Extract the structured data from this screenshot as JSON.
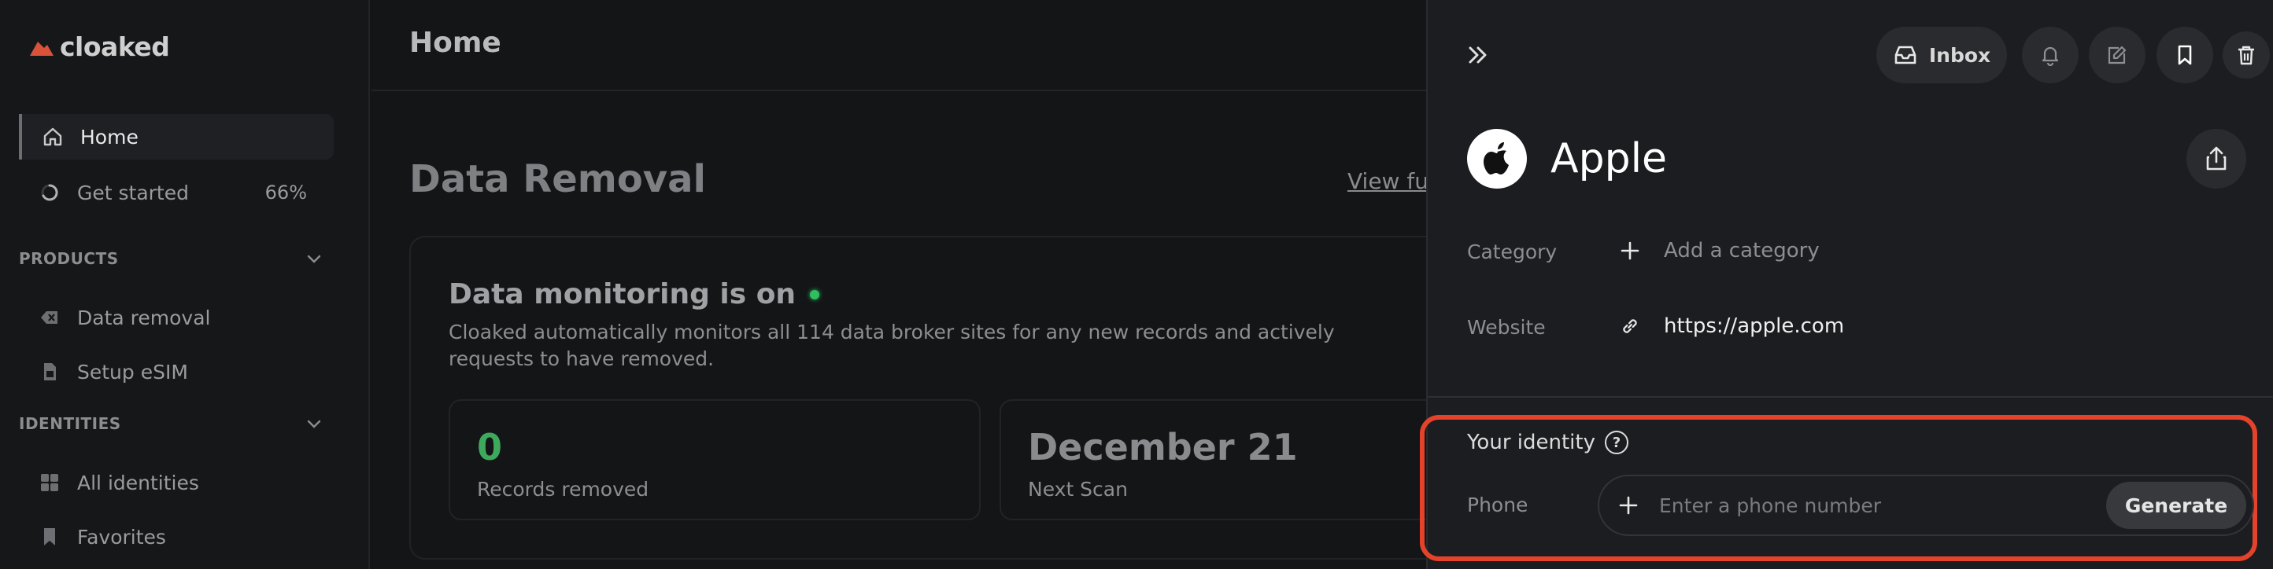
{
  "app": {
    "logo_text": "cloaked"
  },
  "sidebar": {
    "home": "Home",
    "get_started": "Get started",
    "get_started_progress": "66%",
    "products_header": "PRODUCTS",
    "data_removal": "Data removal",
    "setup_esim": "Setup eSIM",
    "identities_header": "IDENTITIES",
    "all_identities": "All identities",
    "favorites": "Favorites"
  },
  "main": {
    "page_title": "Home",
    "section_title": "Data Removal",
    "view_full": "View ful",
    "monitoring_title": "Data monitoring is on",
    "monitoring_desc": "Cloaked automatically monitors all 114 data broker sites for any new records and actively requests to have removed.",
    "stats": [
      {
        "value": "0",
        "label": "Records removed",
        "color": "#3ea95c"
      },
      {
        "value": "December 21",
        "label": "Next Scan",
        "color": "#8a8b8e"
      }
    ]
  },
  "panel": {
    "inbox_label": "Inbox",
    "app_name": "Apple",
    "category_label": "Category",
    "category_value": "Add a category",
    "website_label": "Website",
    "website_value": "https://apple.com",
    "identity_title": "Your identity",
    "phone_label": "Phone",
    "phone_placeholder": "Enter a phone number",
    "generate_label": "Generate"
  },
  "colors": {
    "highlight": "#e2432a",
    "logo_accent": "#d9533b",
    "status_green": "#2fbf5f"
  }
}
